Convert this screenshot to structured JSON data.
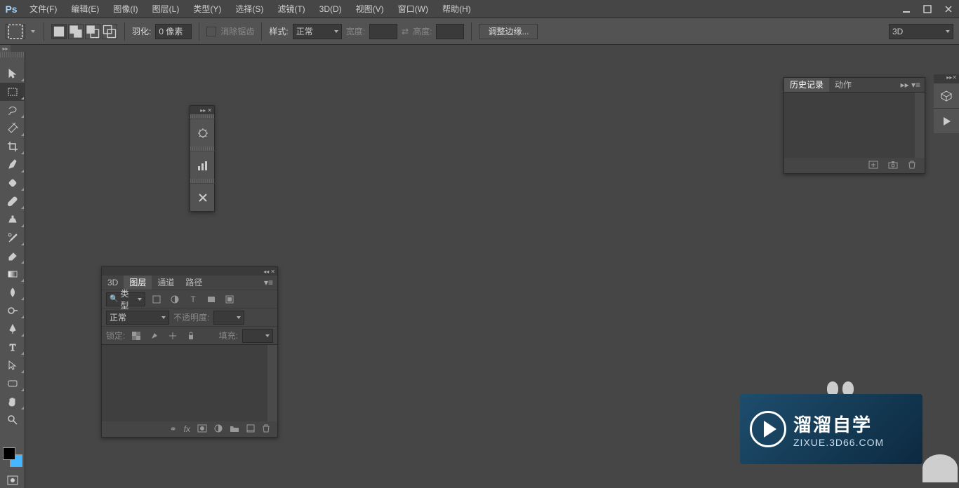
{
  "app": {
    "logo": "Ps"
  },
  "menu": {
    "file": "文件(F)",
    "edit": "编辑(E)",
    "image": "图像(I)",
    "layer": "图层(L)",
    "type": "类型(Y)",
    "select": "选择(S)",
    "filter": "滤镜(T)",
    "threeD": "3D(D)",
    "view": "视图(V)",
    "window": "窗口(W)",
    "help": "帮助(H)"
  },
  "optbar": {
    "feather_label": "羽化:",
    "feather_value": "0 像素",
    "antialias_label": "消除锯齿",
    "style_label": "样式:",
    "style_value": "正常",
    "width_label": "宽度:",
    "width_value": "",
    "height_label": "高度:",
    "height_value": "",
    "refine_label": "调整边缘...",
    "mode3d": "3D"
  },
  "history": {
    "tab_history": "历史记录",
    "tab_actions": "动作"
  },
  "layers": {
    "tab_3d": "3D",
    "tab_layers": "图层",
    "tab_channels": "通道",
    "tab_paths": "路径",
    "filter_label": "类型",
    "blend_mode": "正常",
    "opacity_label": "不透明度:",
    "opacity_value": "",
    "lock_label": "锁定:",
    "fill_label": "填充:",
    "fill_value": ""
  },
  "watermark": {
    "title": "溜溜自学",
    "url": "ZIXUE.3D66.COM"
  }
}
